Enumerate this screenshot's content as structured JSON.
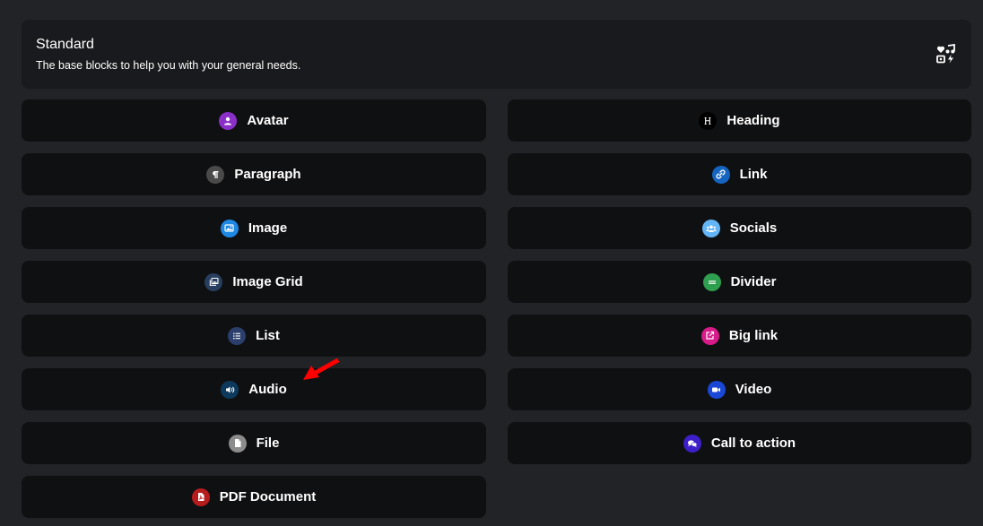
{
  "section": {
    "title": "Standard",
    "description": "The base blocks to help you with your general needs.",
    "icon": "shapes-icon"
  },
  "blocks": [
    {
      "label": "Avatar",
      "icon": "avatar-icon",
      "color": "#8b2fc9"
    },
    {
      "label": "Heading",
      "icon": "heading-icon",
      "color": "#000000"
    },
    {
      "label": "Paragraph",
      "icon": "paragraph-icon",
      "color": "#4a4a4a"
    },
    {
      "label": "Link",
      "icon": "link-icon",
      "color": "#1565c0"
    },
    {
      "label": "Image",
      "icon": "image-icon",
      "color": "#1e88e5"
    },
    {
      "label": "Socials",
      "icon": "socials-icon",
      "color": "#64b5f6"
    },
    {
      "label": "Image Grid",
      "icon": "image-grid-icon",
      "color": "#283e5e"
    },
    {
      "label": "Divider",
      "icon": "divider-icon",
      "color": "#2e9e4f"
    },
    {
      "label": "List",
      "icon": "list-icon",
      "color": "#2c3e6b"
    },
    {
      "label": "Big link",
      "icon": "big-link-icon",
      "color": "#d81b8a"
    },
    {
      "label": "Audio",
      "icon": "audio-icon",
      "color": "#0d3a5c"
    },
    {
      "label": "Video",
      "icon": "video-icon",
      "color": "#1a47d6"
    },
    {
      "label": "File",
      "icon": "file-icon",
      "color": "#8c8c8c"
    },
    {
      "label": "Call to action",
      "icon": "call-to-action-icon",
      "color": "#3d1fc9"
    },
    {
      "label": "PDF Document",
      "icon": "pdf-icon",
      "color": "#b71c1c"
    }
  ],
  "annotation": {
    "icon": "red-arrow-icon",
    "color": "#ff0000"
  }
}
